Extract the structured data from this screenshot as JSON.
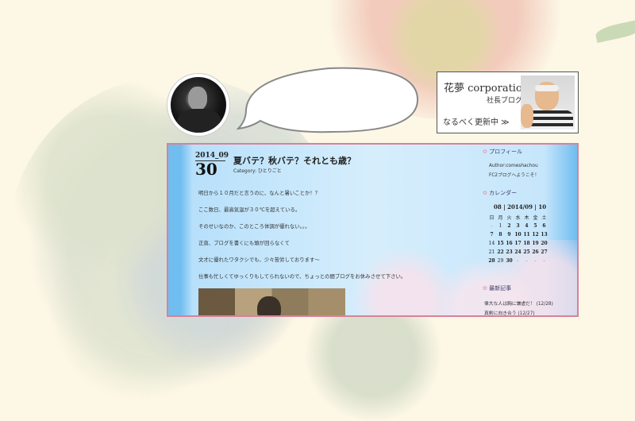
{
  "banner": {
    "title": "花夢 corporation",
    "subtitle": "社長ブログ",
    "link": "なるべく更新中 ≫"
  },
  "blog": {
    "date_month": "2014_09",
    "date_day": "30",
    "post_title": "夏バテ？秋バテ？それとも歳？",
    "category": "Category: ひとりごと",
    "paragraphs": [
      "明日から１０月だと言うのに、なんと暑いことか！？",
      "ここ数日、最高気温が３０℃を超えている。",
      "そのせいなのか、このところ体調が優れない。。。",
      "正直、ブログを書くにも頭が回らなくて",
      "文才に優れたワタクシでも、少々苦労しております～",
      "仕事も忙しくてゆっくりもしてられないので、ちょっとの間ブログをお休みさせて下さい。"
    ],
    "sidebar": {
      "profile_heading": "プロフィール",
      "author": "Author:comeshachou",
      "welcome": "FC2ブログへようこそ！",
      "calendar_heading": "カレンダー",
      "calendar_title": "08 | 2014/09 | 10",
      "weekdays": [
        "日",
        "月",
        "火",
        "水",
        "木",
        "金",
        "土"
      ],
      "weeks": [
        [
          "-",
          "1",
          "2",
          "3",
          "4",
          "5",
          "6"
        ],
        [
          "7",
          "8",
          "9",
          "10",
          "11",
          "12",
          "13"
        ],
        [
          "14",
          "15",
          "16",
          "17",
          "18",
          "19",
          "20"
        ],
        [
          "21",
          "22",
          "23",
          "24",
          "25",
          "26",
          "27"
        ],
        [
          "28",
          "29",
          "30",
          "-",
          "-",
          "-",
          "-"
        ]
      ],
      "recent_heading": "最新記事",
      "recent_posts": [
        "偉大な人は胸に謙虚だ！ (12/28)",
        "真剣に向き合う (12/27)"
      ]
    }
  }
}
